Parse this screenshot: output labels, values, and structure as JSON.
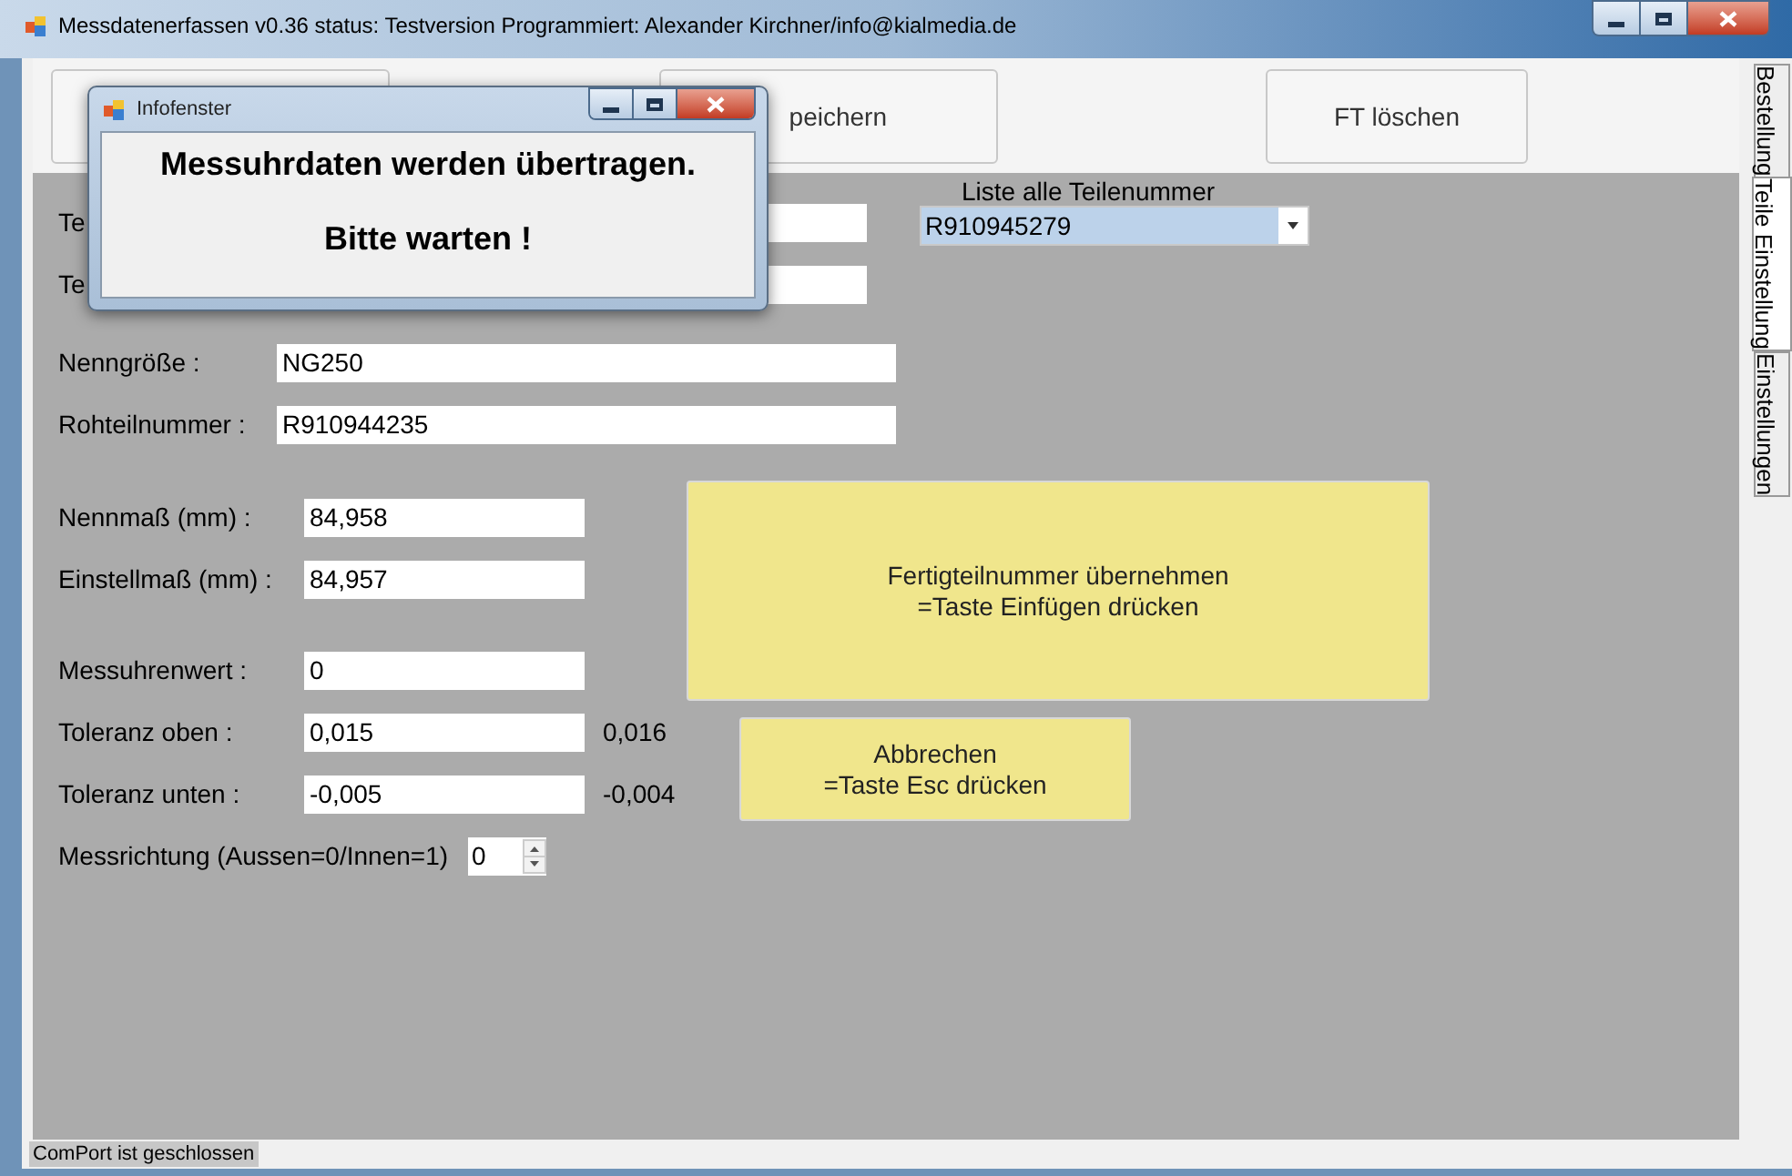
{
  "window": {
    "title": "Messdatenerfassen  v0.36  status: Testversion  Programmiert: Alexander Kirchner/info@kialmedia.de"
  },
  "top_buttons": [
    {
      "kind": "blank"
    },
    {
      "label": "peichern"
    },
    {
      "label": "FT löschen"
    }
  ],
  "side_tabs": [
    {
      "label": "Bestellung",
      "selected": false
    },
    {
      "label": "Teile Einstellung",
      "selected": true
    },
    {
      "label": "Einstellungen",
      "selected": false
    }
  ],
  "part_list": {
    "label": "Liste alle Teilenummer",
    "value": "R910945279",
    "selected": true
  },
  "field_groups": [
    [
      {
        "kind": "wide",
        "label": "Te"
      },
      {
        "kind": "wide",
        "label": "Te"
      },
      {
        "kind": "wide",
        "label": "Nenngröße :",
        "value": "NG250"
      },
      {
        "kind": "wide",
        "label": "Rohteilnummer :",
        "value": "R910944235"
      }
    ],
    [
      {
        "kind": "narrow",
        "label": "Nennmaß (mm) :",
        "value": "84,958"
      },
      {
        "kind": "narrow",
        "label": "Einstellmaß (mm) :",
        "value": "84,957"
      }
    ],
    [
      {
        "kind": "narrow",
        "label": "Messuhrenwert :",
        "value": "0"
      },
      {
        "kind": "narrow",
        "label": "Toleranz oben :",
        "value": "0,015",
        "reading": "0,016"
      },
      {
        "kind": "narrow",
        "label": "Toleranz unten :",
        "value": "-0,005",
        "reading": "-0,004"
      },
      {
        "kind": "spinner",
        "label": "Messrichtung (Aussen=0/Innen=1)",
        "value": "0"
      }
    ]
  ],
  "action_buttons": [
    {
      "kind": "large",
      "lines": [
        "Fertigteilnummer übernehmen",
        "=Taste Einfügen drücken"
      ]
    },
    {
      "kind": "small",
      "lines": [
        "Abbrechen",
        "=Taste Esc drücken"
      ]
    }
  ],
  "dialog": {
    "title": "Infofenster",
    "lines": [
      "Messuhrdaten werden übertragen.",
      "Bitte warten !"
    ]
  },
  "status_bar": {
    "text": "ComPort ist geschlossen"
  }
}
